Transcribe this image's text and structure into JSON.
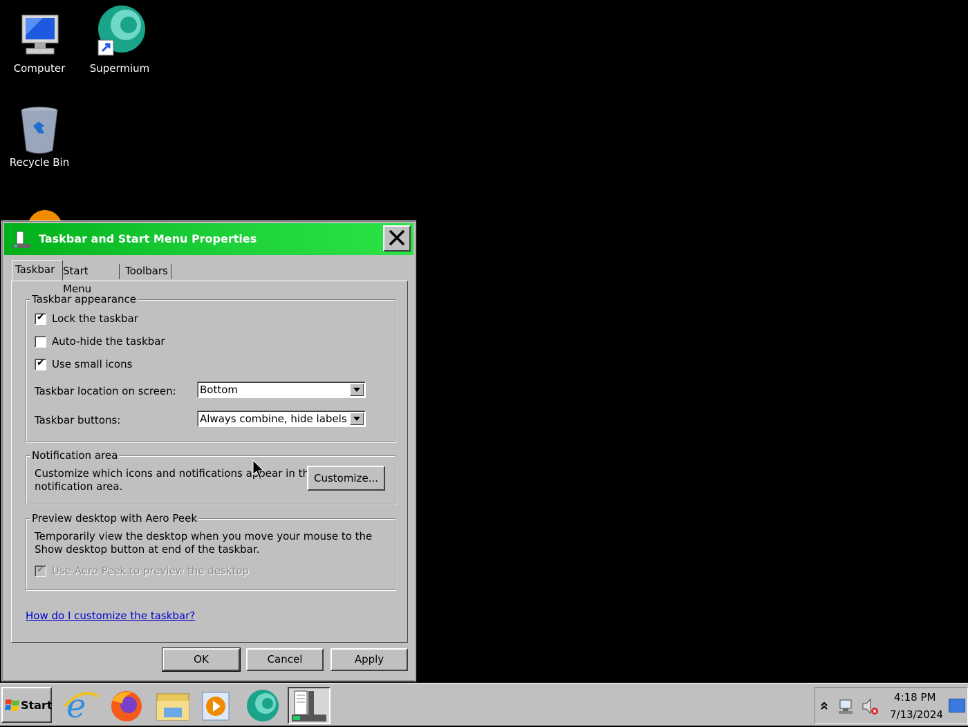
{
  "desktop": {
    "icons": [
      {
        "label": "Computer",
        "icon": "computer-icon"
      },
      {
        "label": "Supermium",
        "icon": "supermium-icon"
      },
      {
        "label": "Recycle Bin",
        "icon": "recycle-bin-icon"
      }
    ]
  },
  "dialog": {
    "title": "Taskbar and Start Menu Properties",
    "tabs": [
      {
        "label": "Taskbar",
        "active": true
      },
      {
        "label": "Start Menu",
        "active": false
      },
      {
        "label": "Toolbars",
        "active": false
      }
    ],
    "appearance": {
      "title": "Taskbar appearance",
      "lock_label": "Lock the taskbar",
      "lock_checked": true,
      "autohide_label": "Auto-hide the taskbar",
      "autohide_checked": false,
      "small_icons_label": "Use small icons",
      "small_icons_checked": true,
      "location_label": "Taskbar location on screen:",
      "location_value": "Bottom",
      "buttons_label": "Taskbar buttons:",
      "buttons_value": "Always combine, hide labels"
    },
    "notification": {
      "title": "Notification area",
      "text_line1": "Customize which icons and notifications appear in the",
      "text_line2": "notification area.",
      "customize_button": "Customize..."
    },
    "aero_peek": {
      "title": "Preview desktop with Aero Peek",
      "text_line1": "Temporarily view the desktop when you move your mouse to the",
      "text_line2": "Show desktop button at end of the taskbar.",
      "checkbox_label": "Use Aero Peek to preview the desktop",
      "checkbox_checked": true,
      "checkbox_enabled": false
    },
    "help_link": "How do I customize the taskbar?",
    "buttons": {
      "ok": "OK",
      "cancel": "Cancel",
      "apply": "Apply"
    }
  },
  "taskbar": {
    "start_label": "Start",
    "apps": [
      "internet-explorer-icon",
      "firefox-icon",
      "file-explorer-icon",
      "media-player-icon",
      "supermium-icon",
      "taskbar-properties-icon"
    ],
    "clock_time": "4:18 PM",
    "clock_date": "7/13/2024"
  },
  "colors": {
    "titlebar_start": "#00b01a",
    "titlebar_end": "#2ce347",
    "desktop": "#000000",
    "face": "#c0c0c0",
    "link": "#0000cc"
  }
}
